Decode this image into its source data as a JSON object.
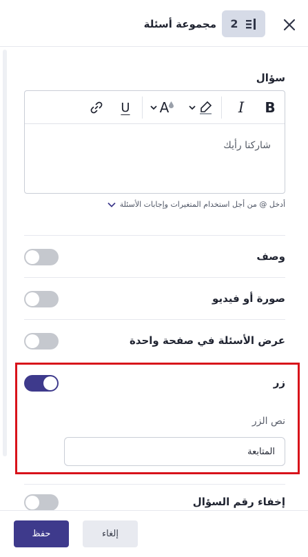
{
  "header": {
    "title": "مجموعة أسئلة",
    "question_count": "2",
    "close_icon": "close-icon",
    "list_icon": "list-icon"
  },
  "question_section": {
    "label": "سؤال",
    "toolbar": {
      "bold": "B",
      "italic": "I",
      "underline": "U",
      "font_color_letter": "A"
    },
    "editor_text": "شاركنا رأيك",
    "hint": "أدخل @ من أجل استخدام المتغيرات وإجابات الأسئلة"
  },
  "settings": [
    {
      "label": "وصف",
      "enabled": false
    },
    {
      "label": "صورة أو فيديو",
      "enabled": false
    },
    {
      "label": "عرض الأسئلة في صفحة واحدة",
      "enabled": false
    },
    {
      "label": "زر",
      "enabled": true
    },
    {
      "label": "إخفاء رقم السؤال",
      "enabled": false
    }
  ],
  "button_settings": {
    "field_label": "نص الزر",
    "field_value": "المتابعة"
  },
  "footer": {
    "save_label": "حفظ",
    "cancel_label": "إلغاء"
  },
  "colors": {
    "accent": "#3e3a8c",
    "highlight": "#d8121a",
    "toggle_off": "#c5c8ce"
  }
}
